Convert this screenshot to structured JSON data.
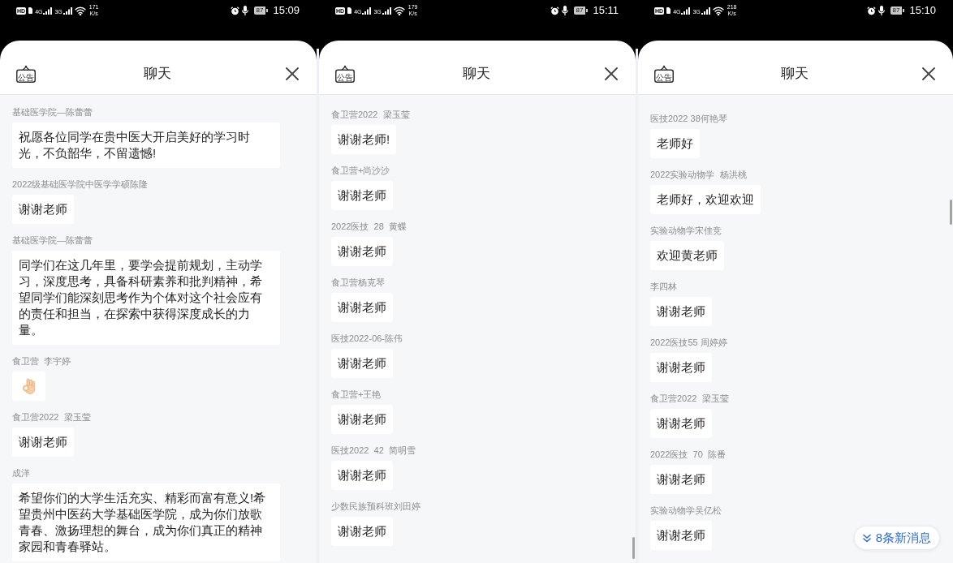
{
  "screens": [
    {
      "status_bar": {
        "hd_badge": "HD",
        "network_1": "4G",
        "network_2": "3G",
        "speed": "171",
        "speed_unit": "K/s",
        "battery": "87",
        "time": "15:09"
      },
      "header": {
        "notice_label": "公告",
        "title": "聊天"
      },
      "messages": [
        {
          "sender": "基础医学院—陈蕾蕾",
          "kind": "text",
          "text": "祝愿各位同学在贵中医大开启美好的学习时光，不负韶华，不留遗憾!"
        },
        {
          "sender": "2022级基础医学院中医学学硕陈隆",
          "kind": "text",
          "text": "谢谢老师"
        },
        {
          "sender": "基础医学院—陈蕾蕾",
          "kind": "text",
          "text": "同学们在这几年里，要学会提前规划，主动学习，深度思考，具备科研素养和批判精神，希望同学们能深刻思考作为个体对这个社会应有的责任和担当，在探索中获得深度成长的力量。"
        },
        {
          "sender": "食卫营  李宇婷",
          "kind": "emoji"
        },
        {
          "sender": "食卫营2022  梁玉莹",
          "kind": "text",
          "text": "谢谢老师"
        },
        {
          "sender": "成洋",
          "kind": "text",
          "text": "希望你们的大学生活充实、精彩而富有意义!希望贵州中医药大学基础医学院，成为你们放歌青春、激扬理想的舞台，成为你们真正的精神家园和青春驿站。"
        }
      ]
    },
    {
      "status_bar": {
        "hd_badge": "HD",
        "network_1": "4G",
        "network_2": "3G",
        "speed": "179",
        "speed_unit": "K/s",
        "battery": "87",
        "time": "15:11"
      },
      "header": {
        "notice_label": "公告",
        "title": "聊天"
      },
      "messages": [
        {
          "sender": "食卫营2022  梁玉莹",
          "kind": "text",
          "text": "谢谢老师!"
        },
        {
          "sender": "食卫营+尚沙沙",
          "kind": "text",
          "text": "谢谢老师"
        },
        {
          "sender": "2022医技  28  黄蝶",
          "kind": "text",
          "text": "谢谢老师"
        },
        {
          "sender": "食卫营杨克琴",
          "kind": "text",
          "text": "谢谢老师"
        },
        {
          "sender": "医技2022-06-陈伟",
          "kind": "text",
          "text": "谢谢老师"
        },
        {
          "sender": "食卫营+王艳",
          "kind": "text",
          "text": "谢谢老师"
        },
        {
          "sender": "医技2022  42  简明雪",
          "kind": "text",
          "text": "谢谢老师"
        },
        {
          "sender": "少数民族预科班刘田婷",
          "kind": "text",
          "text": "谢谢老师"
        }
      ]
    },
    {
      "status_bar": {
        "hd_badge": "HD",
        "network_1": "4G",
        "network_2": "3G",
        "speed": "218",
        "speed_unit": "K/s",
        "battery": "87",
        "time": "15:10"
      },
      "header": {
        "notice_label": "公告",
        "title": "聊天"
      },
      "messages": [
        {
          "sender": "医技2022 38何艳琴",
          "kind": "text",
          "text": "老师好"
        },
        {
          "sender": "2022实验动物学  杨洪桃",
          "kind": "text",
          "text": "老师好，欢迎欢迎"
        },
        {
          "sender": "实验动物学宋佳竞",
          "kind": "text",
          "text": "欢迎黄老师"
        },
        {
          "sender": "李四林",
          "kind": "text",
          "text": "谢谢老师"
        },
        {
          "sender": "2022医技55 周婷婷",
          "kind": "text",
          "text": "谢谢老师"
        },
        {
          "sender": "食卫营2022  梁玉莹",
          "kind": "text",
          "text": "谢谢老师"
        },
        {
          "sender": "2022医技  70  陈番",
          "kind": "text",
          "text": "谢谢老师"
        },
        {
          "sender": "实验动物学吴亿松",
          "kind": "text",
          "text": "谢谢老师"
        }
      ],
      "new_messages_button": "8条新消息"
    }
  ]
}
